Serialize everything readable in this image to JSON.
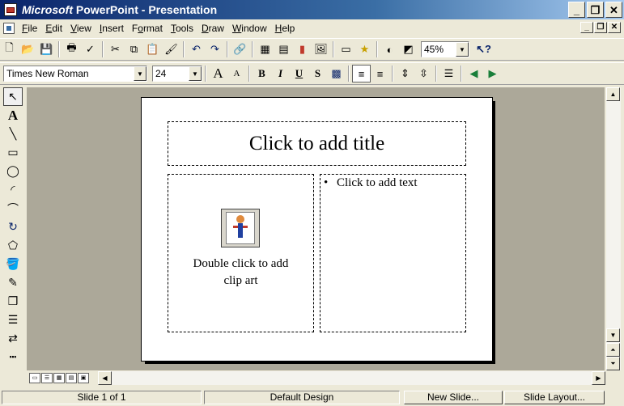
{
  "window": {
    "title_brand": "Microsoft",
    "title_rest": " PowerPoint - Presentation"
  },
  "menu": {
    "items": [
      "File",
      "Edit",
      "View",
      "Insert",
      "Format",
      "Tools",
      "Draw",
      "Window",
      "Help"
    ],
    "mnemonics": [
      "F",
      "E",
      "V",
      "I",
      "o",
      "T",
      "D",
      "W",
      "H"
    ]
  },
  "toolbar": {
    "zoom": "45%",
    "font_name": "Times New Roman",
    "font_size": "24",
    "bold": "B",
    "italic": "I",
    "underline": "U",
    "shadow": "S",
    "grow_font": "A",
    "shrink_font": "A"
  },
  "slide": {
    "title_placeholder": "Click to add title",
    "clipart_placeholder_line1": "Double click to add",
    "clipart_placeholder_line2": "clip art",
    "text_bullet": "•",
    "text_placeholder": "Click to add text"
  },
  "statusbar": {
    "slide_indicator": "Slide 1 of 1",
    "design": "Default Design",
    "new_slide": "New Slide...",
    "slide_layout": "Slide Layout..."
  }
}
